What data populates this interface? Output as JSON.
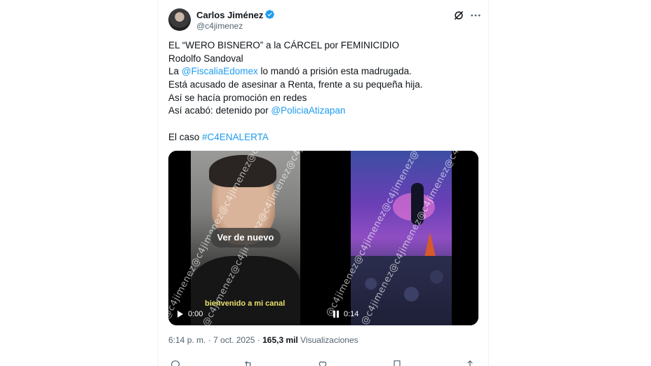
{
  "author": {
    "name": "Carlos Jiménez",
    "handle": "@c4jimenez"
  },
  "tweet": {
    "lines": [
      {
        "text": "EL “WERO BISNERO” a la CÁRCEL por FEMINICIDIO"
      },
      {
        "text": "Rodolfo Sandoval"
      },
      {
        "pre": "La ",
        "link": "@FiscaliaEdomex",
        "post": " lo mandó a prisión esta madrugada."
      },
      {
        "text": "Está acusado de asesinar a Renta, frente a su pequeña hija."
      },
      {
        "text": "Así se hacía promoción en redes"
      },
      {
        "pre": "Así acabó: detenido por ",
        "link": "@PoliciaAtizapan",
        "post": ""
      },
      {
        "pre": "El caso ",
        "link": "#C4ENALERTA",
        "post": ""
      }
    ]
  },
  "media": {
    "left_video": {
      "replay_label": "Ver de nuevo",
      "caption": "bienvenido a mi canal",
      "time": "0:00",
      "watermark": "@c4jimenez@c4jimenez@c4jimenez@c4jimenez"
    },
    "right_video": {
      "time": "0:14",
      "watermark": "@c4jimenez@c4jimenez@c4jimenez@c4jimenez"
    }
  },
  "meta": {
    "time": "6:14 p. m.",
    "separator": " · ",
    "date": "7 oct. 2025",
    "views_count": "165,3 mil",
    "views_label": "Visualizaciones"
  },
  "colors": {
    "link": "#1d9bf0",
    "verified": "#1d9bf0",
    "text": "#0f1419",
    "muted": "#536471"
  },
  "icons": [
    "verified-badge-icon",
    "grok-icon",
    "more-icon",
    "play-icon",
    "pause-icon",
    "reply-icon",
    "retweet-icon",
    "like-icon",
    "bookmark-icon",
    "share-icon"
  ]
}
